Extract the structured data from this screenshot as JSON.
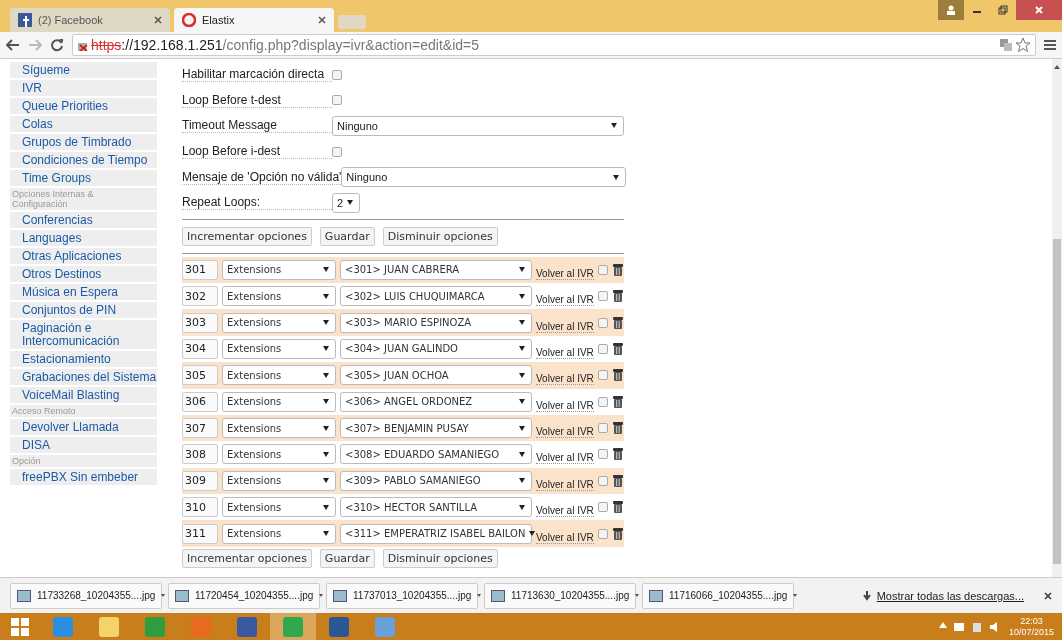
{
  "browser": {
    "tabs": [
      {
        "title": "(2) Facebook",
        "selected": false
      },
      {
        "title": "Elastix",
        "selected": true
      }
    ],
    "address": {
      "scheme": "https",
      "host": "://192.168.1.251",
      "path": "/config.php?display=ivr&action=edit&id=5"
    }
  },
  "sidebar": {
    "items": [
      {
        "kind": "item",
        "label": "Sígueme"
      },
      {
        "kind": "item",
        "label": "IVR"
      },
      {
        "kind": "item",
        "label": "Queue Priorities"
      },
      {
        "kind": "item",
        "label": "Colas"
      },
      {
        "kind": "item",
        "label": "Grupos de Timbrado"
      },
      {
        "kind": "item",
        "label": "Condiciones de Tiempo"
      },
      {
        "kind": "item",
        "label": "Time Groups"
      },
      {
        "kind": "header",
        "label": "Opciones Internas & Configuración"
      },
      {
        "kind": "item",
        "label": "Conferencias"
      },
      {
        "kind": "item",
        "label": "Languages"
      },
      {
        "kind": "item",
        "label": "Otras Aplicaciones"
      },
      {
        "kind": "item",
        "label": "Otros Destinos"
      },
      {
        "kind": "item",
        "label": "Música en Espera"
      },
      {
        "kind": "item",
        "label": "Conjuntos de PIN"
      },
      {
        "kind": "item",
        "label": "Paginación e Intercomunicación"
      },
      {
        "kind": "item",
        "label": "Estacionamiento"
      },
      {
        "kind": "item",
        "label": "Grabaciones del Sistema"
      },
      {
        "kind": "item",
        "label": "VoiceMail Blasting"
      },
      {
        "kind": "header",
        "label": "Acceso Remoto"
      },
      {
        "kind": "item",
        "label": "Devolver Llamada"
      },
      {
        "kind": "item",
        "label": "DISA"
      },
      {
        "kind": "header",
        "label": "Opción"
      },
      {
        "kind": "item",
        "label": "freePBX Sin embeber"
      }
    ]
  },
  "settings": [
    {
      "kind": "checkbox",
      "label": "Habilitar marcación directa",
      "checked": false
    },
    {
      "kind": "checkbox",
      "label": "Loop Before t-dest",
      "checked": false
    },
    {
      "kind": "select",
      "label": "Timeout Message",
      "value": "Ninguno"
    },
    {
      "kind": "checkbox",
      "label": "Loop Before i-dest",
      "checked": false
    },
    {
      "kind": "select",
      "label": "Mensaje de 'Opción no válida'",
      "value": "Ninguno"
    },
    {
      "kind": "small_select",
      "label": "Repeat Loops:",
      "value": "2"
    }
  ],
  "buttons_top": [
    "Incrementar opciones",
    "Guardar",
    "Disminuir opciones"
  ],
  "options": [
    {
      "digit": "301",
      "type": "Extensions",
      "destination": "<301> JUAN CABRERA",
      "return_label": "Volver al IVR",
      "checked": false
    },
    {
      "digit": "302",
      "type": "Extensions",
      "destination": "<302> LUIS CHUQUIMARCA",
      "return_label": "Volver al IVR",
      "checked": false
    },
    {
      "digit": "303",
      "type": "Extensions",
      "destination": "<303> MARIO ESPINOZA",
      "return_label": "Volver al IVR",
      "checked": false
    },
    {
      "digit": "304",
      "type": "Extensions",
      "destination": "<304> JUAN GALINDO",
      "return_label": "Volver al IVR",
      "checked": false
    },
    {
      "digit": "305",
      "type": "Extensions",
      "destination": "<305> JUAN OCHOA",
      "return_label": "Volver al IVR",
      "checked": false
    },
    {
      "digit": "306",
      "type": "Extensions",
      "destination": "<306> ANGEL ORDONEZ",
      "return_label": "Volver al IVR",
      "checked": false
    },
    {
      "digit": "307",
      "type": "Extensions",
      "destination": "<307> BENJAMIN PUSAY",
      "return_label": "Volver al IVR",
      "checked": false
    },
    {
      "digit": "308",
      "type": "Extensions",
      "destination": "<308> EDUARDO SAMANIEGO",
      "return_label": "Volver al IVR",
      "checked": false
    },
    {
      "digit": "309",
      "type": "Extensions",
      "destination": "<309> PABLO SAMANIEGO",
      "return_label": "Volver al IVR",
      "checked": false
    },
    {
      "digit": "310",
      "type": "Extensions",
      "destination": "<310> HECTOR SANTILLA",
      "return_label": "Volver al IVR",
      "checked": false
    },
    {
      "digit": "311",
      "type": "Extensions",
      "destination": "<311> EMPERATRIZ ISABEL BAILON",
      "return_label": "Volver al IVR",
      "checked": false
    }
  ],
  "buttons_bottom": [
    "Incrementar opciones",
    "Guardar",
    "Disminuir opciones"
  ],
  "downloads": {
    "files": [
      "11733268_10204355....jpg",
      "11720454_10204355....jpg",
      "11737013_10204355....jpg",
      "11713630_10204355....jpg",
      "11716066_10204355....jpg"
    ],
    "show_all": "Mostrar todas las descargas..."
  },
  "taskbar": {
    "apps": [
      {
        "kind": "ie",
        "active": false
      },
      {
        "kind": "explorer",
        "active": false
      },
      {
        "kind": "store",
        "active": false
      },
      {
        "kind": "firefox",
        "active": false
      },
      {
        "kind": "virtualbox",
        "active": false
      },
      {
        "kind": "chrome",
        "active": true
      },
      {
        "kind": "word",
        "active": false
      },
      {
        "kind": "network",
        "active": false
      }
    ],
    "time": "22:03",
    "date": "10/07/2015"
  }
}
